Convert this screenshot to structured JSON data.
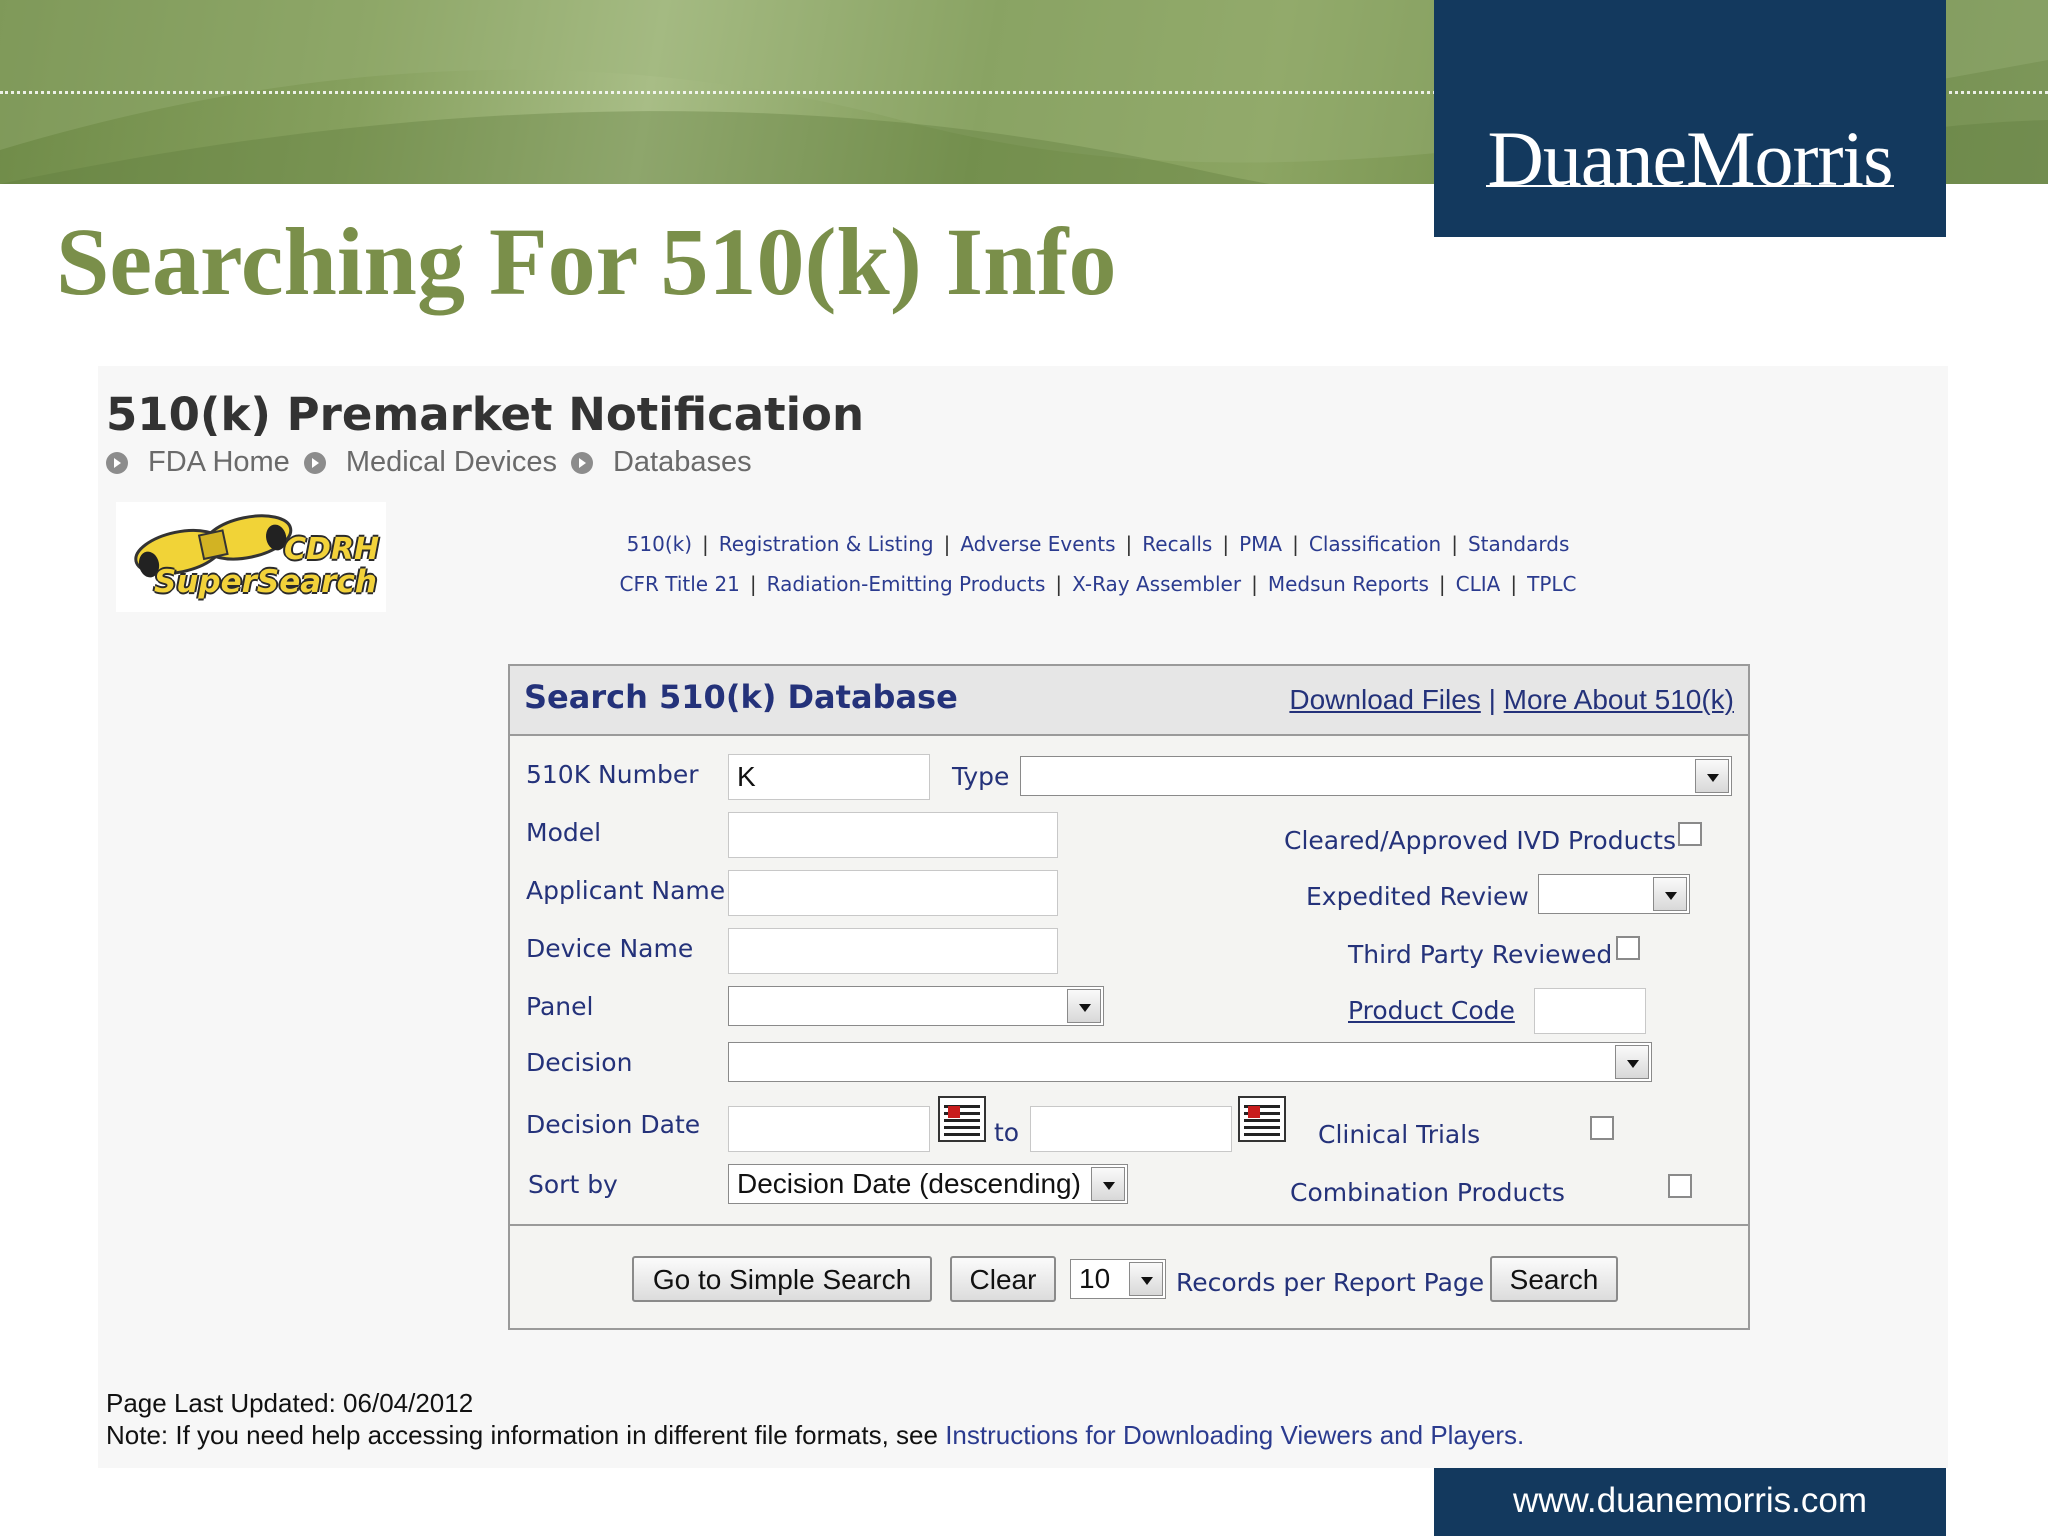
{
  "slide": {
    "title": "Searching For 510(k) Info",
    "brand": "DuaneMorris",
    "footer_url": "www.duanemorris.com"
  },
  "page": {
    "title": "510(k) Premarket Notification",
    "breadcrumb": [
      "FDA Home",
      "Medical Devices",
      "Databases"
    ],
    "logo_text": [
      "CDRH",
      "SuperSearch"
    ],
    "nav_row1": [
      "510(k)",
      "Registration & Listing",
      "Adverse Events",
      "Recalls",
      "PMA",
      "Classification",
      "Standards"
    ],
    "nav_row2": [
      "CFR Title 21",
      "Radiation-Emitting Products",
      "X-Ray Assembler",
      "Medsun Reports",
      "CLIA",
      "TPLC"
    ]
  },
  "search": {
    "title": "Search 510(k) Database",
    "link_download": "Download Files",
    "link_separator": "|",
    "link_more": "More About 510(k)",
    "labels": {
      "k_number": "510K Number",
      "type": "Type",
      "model": "Model",
      "applicant": "Applicant Name",
      "device": "Device Name",
      "panel": "Panel",
      "decision": "Decision",
      "decision_date": "Decision Date",
      "to": "to",
      "sort_by": "Sort by",
      "ivd": "Cleared/Approved IVD Products",
      "expedited": "Expedited Review",
      "third_party": "Third Party Reviewed",
      "product_code": "Product Code",
      "clinical_trials": "Clinical Trials",
      "combination": "Combination Products"
    },
    "values": {
      "k_number": "K",
      "type": "",
      "model": "",
      "applicant": "",
      "device": "",
      "panel": "",
      "decision": "",
      "date_from": "",
      "date_to": "",
      "sort_by": "Decision Date (descending)",
      "expedited": "",
      "product_code": "",
      "records": "10"
    },
    "checkboxes": {
      "ivd": false,
      "third_party": false,
      "clinical_trials": false,
      "combination": false
    },
    "buttons": {
      "simple": "Go to Simple Search",
      "clear": "Clear",
      "search": "Search"
    },
    "records_label": "Records per Report Page"
  },
  "footer": {
    "updated": "Page Last Updated: 06/04/2012",
    "note_prefix": "Note: If you need help accessing information in different file formats, see ",
    "note_link": "Instructions for Downloading Viewers and Players."
  },
  "colors": {
    "banner_green": "#7f9a57",
    "navy": "#13395e",
    "title_green": "#7a8f4a",
    "form_label_blue": "#24327a"
  }
}
